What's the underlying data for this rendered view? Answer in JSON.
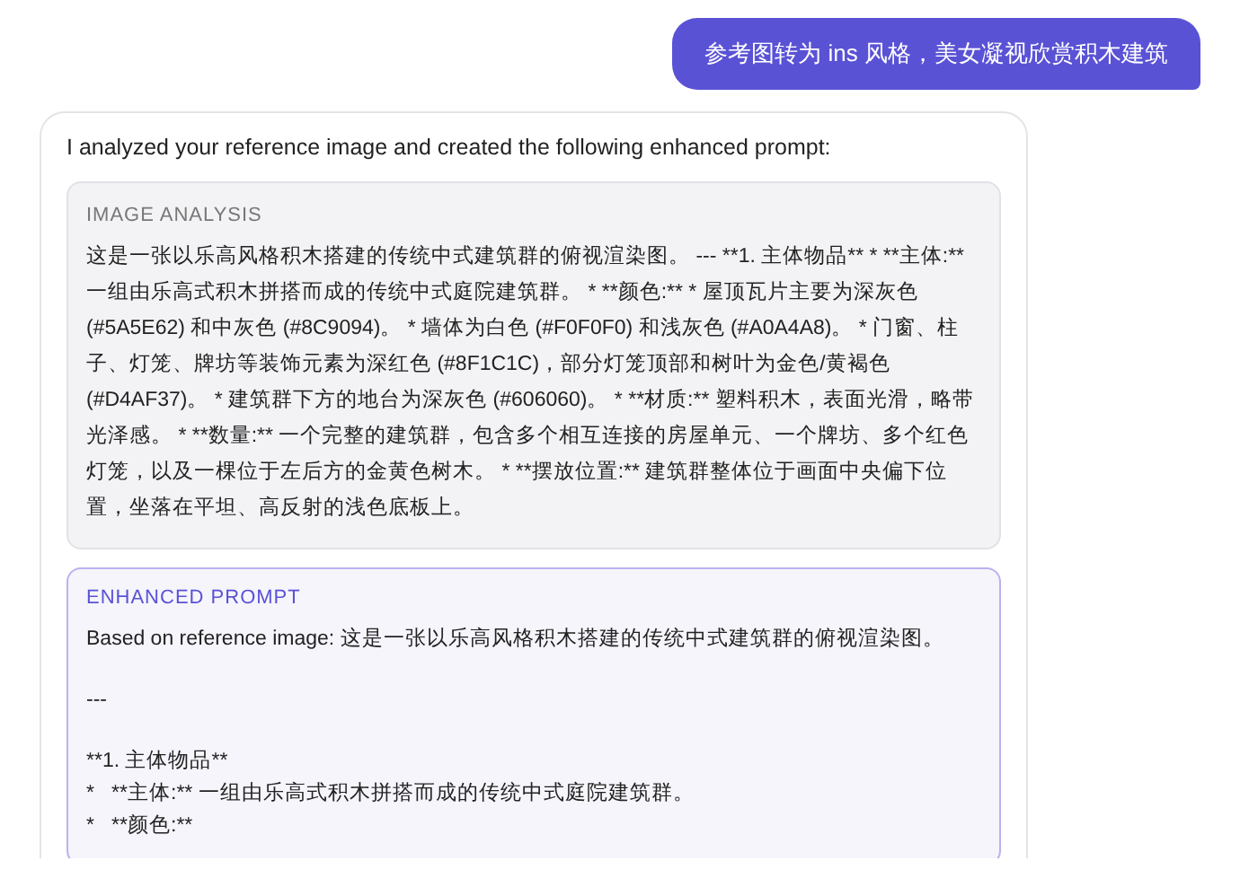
{
  "user_message": "参考图转为 ins 风格，美女凝视欣赏积木建筑",
  "assistant_message": {
    "intro": "I analyzed your reference image and created the following enhanced prompt:",
    "analysis": {
      "label": "IMAGE ANALYSIS",
      "text": "这是一张以乐高风格积木搭建的传统中式建筑群的俯视渲染图。 --- **1. 主体物品** * **主体:** 一组由乐高式积木拼搭而成的传统中式庭院建筑群。 * **颜色:** * 屋顶瓦片主要为深灰色 (#5A5E62) 和中灰色 (#8C9094)。 * 墙体为白色 (#F0F0F0) 和浅灰色 (#A0A4A8)。 * 门窗、柱子、灯笼、牌坊等装饰元素为深红色 (#8F1C1C)，部分灯笼顶部和树叶为金色/黄褐色 (#D4AF37)。 * 建筑群下方的地台为深灰色 (#606060)。 * **材质:** 塑料积木，表面光滑，略带光泽感。 * **数量:** 一个完整的建筑群，包含多个相互连接的房屋单元、一个牌坊、多个红色灯笼，以及一棵位于左后方的金黄色树木。 * **摆放位置:** 建筑群整体位于画面中央偏下位置，坐落在平坦、高反射的浅色底板上。"
    },
    "enhanced": {
      "label": "ENHANCED PROMPT",
      "blocks": [
        {
          "lines": [
            "Based on reference image: 这是一张以乐高风格积木搭建的传统中式建筑群的俯视渲染图。"
          ]
        },
        {
          "lines": [
            "---"
          ]
        },
        {
          "lines": [
            "**1. 主体物品**",
            "*   **主体:** 一组由乐高式积木拼搭而成的传统中式庭院建筑群。",
            "*   **颜色:**"
          ]
        }
      ]
    }
  }
}
